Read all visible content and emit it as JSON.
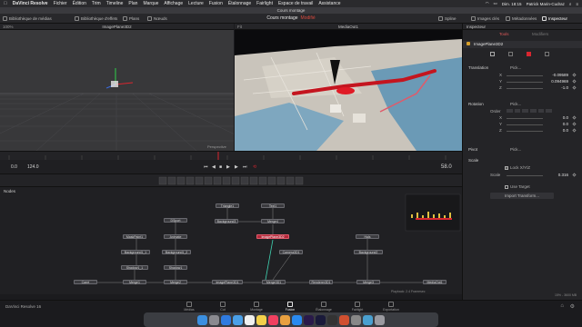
{
  "menubar": {
    "app": "DaVinci Resolve",
    "items": [
      "Fichier",
      "Édition",
      "Trim",
      "Timeline",
      "Plan",
      "Marque",
      "Affichage",
      "Lecture",
      "Fusion",
      "Étalonnage",
      "Fairlight",
      "Espace de travail",
      "Assistance"
    ],
    "clock": "Dim. 18:15",
    "user": "Patrick Marin-Cudraz"
  },
  "titlebar": {
    "title": "Cours montage"
  },
  "toolbar": {
    "media_pool": "Bibliothèque de médias",
    "effects": "Bibliothèque d'effets",
    "clips": "Plans",
    "nodes": "Nœuds",
    "project": "Cours montage",
    "modified": "Modifié",
    "spline": "Spline",
    "keyframes": "Images clés",
    "metadata": "Métadonnées",
    "inspector": "Inspecteur"
  },
  "left_viewer": {
    "title": "ImagePlane3D2",
    "zoom": "100%",
    "overlay": "Perspective"
  },
  "right_viewer": {
    "title": "MediaOut1",
    "zoom": "Fit"
  },
  "transport": {
    "start": "0.0",
    "end": "124.0",
    "current": "58.0"
  },
  "nodes_panel": {
    "label": "Nodes"
  },
  "nodes": [
    "Triangle1",
    "Text1",
    "Background3",
    "Merge4",
    "DSport",
    "ImagePlane3D2",
    "MaskPaint1",
    "Animate",
    "Hals",
    "Camera3D1",
    "Background1_1",
    "Background1_2",
    "Background2",
    "Shadow1_1",
    "Shadow1",
    "Carré",
    "Merge1",
    "Merge2",
    "ImagePlane3D1",
    "Merge3D1",
    "Renderer3D1",
    "Merge3",
    "MediaOut1"
  ],
  "status": {
    "playback": "Playback: 2.4 Framesec",
    "memory": "15% - 3600 MB"
  },
  "inspector": {
    "header": "Inspecteur",
    "tabs": [
      "Tools",
      "Modifiers"
    ],
    "node_name": "ImagePlane3D2",
    "sections": {
      "translation": "Translation",
      "rotation": "Rotation",
      "pivot": "Pivot",
      "scale": "Scale"
    },
    "translation": {
      "pick": "Pick...",
      "x": "-0.09589",
      "y": "0.094969",
      "z": "-1.0"
    },
    "rotation": {
      "order": "Order",
      "pick": "Pick...",
      "x": "0.0",
      "y": "0.0",
      "z": "0.0"
    },
    "pivot_pick": "Pick...",
    "scale": {
      "lock": "Lock X/Y/Z",
      "label": "Scale",
      "value": "0.316"
    },
    "use_target": "Use Target",
    "import_transform": "Import Transform..."
  },
  "pages": [
    "Médias",
    "Cut",
    "Montage",
    "Fusion",
    "Étalonnage",
    "Fairlight",
    "Exportation"
  ],
  "active_page": "Fusion",
  "app_version": "DaVinci Resolve 16",
  "colors": {
    "accent_red": "#d8262f",
    "selected_node": "#b3293a",
    "bg": "#1b1b1e"
  },
  "dock_apps": [
    "finder-icon",
    "launchpad-icon",
    "safari-icon",
    "mail-icon",
    "calendar-icon",
    "notes-icon",
    "music-icon",
    "photos-icon",
    "app-store-icon",
    "premiere-icon",
    "after-effects-icon",
    "resolve-icon",
    "files-icon",
    "system-prefs-icon",
    "preview-icon",
    "trash-icon"
  ]
}
